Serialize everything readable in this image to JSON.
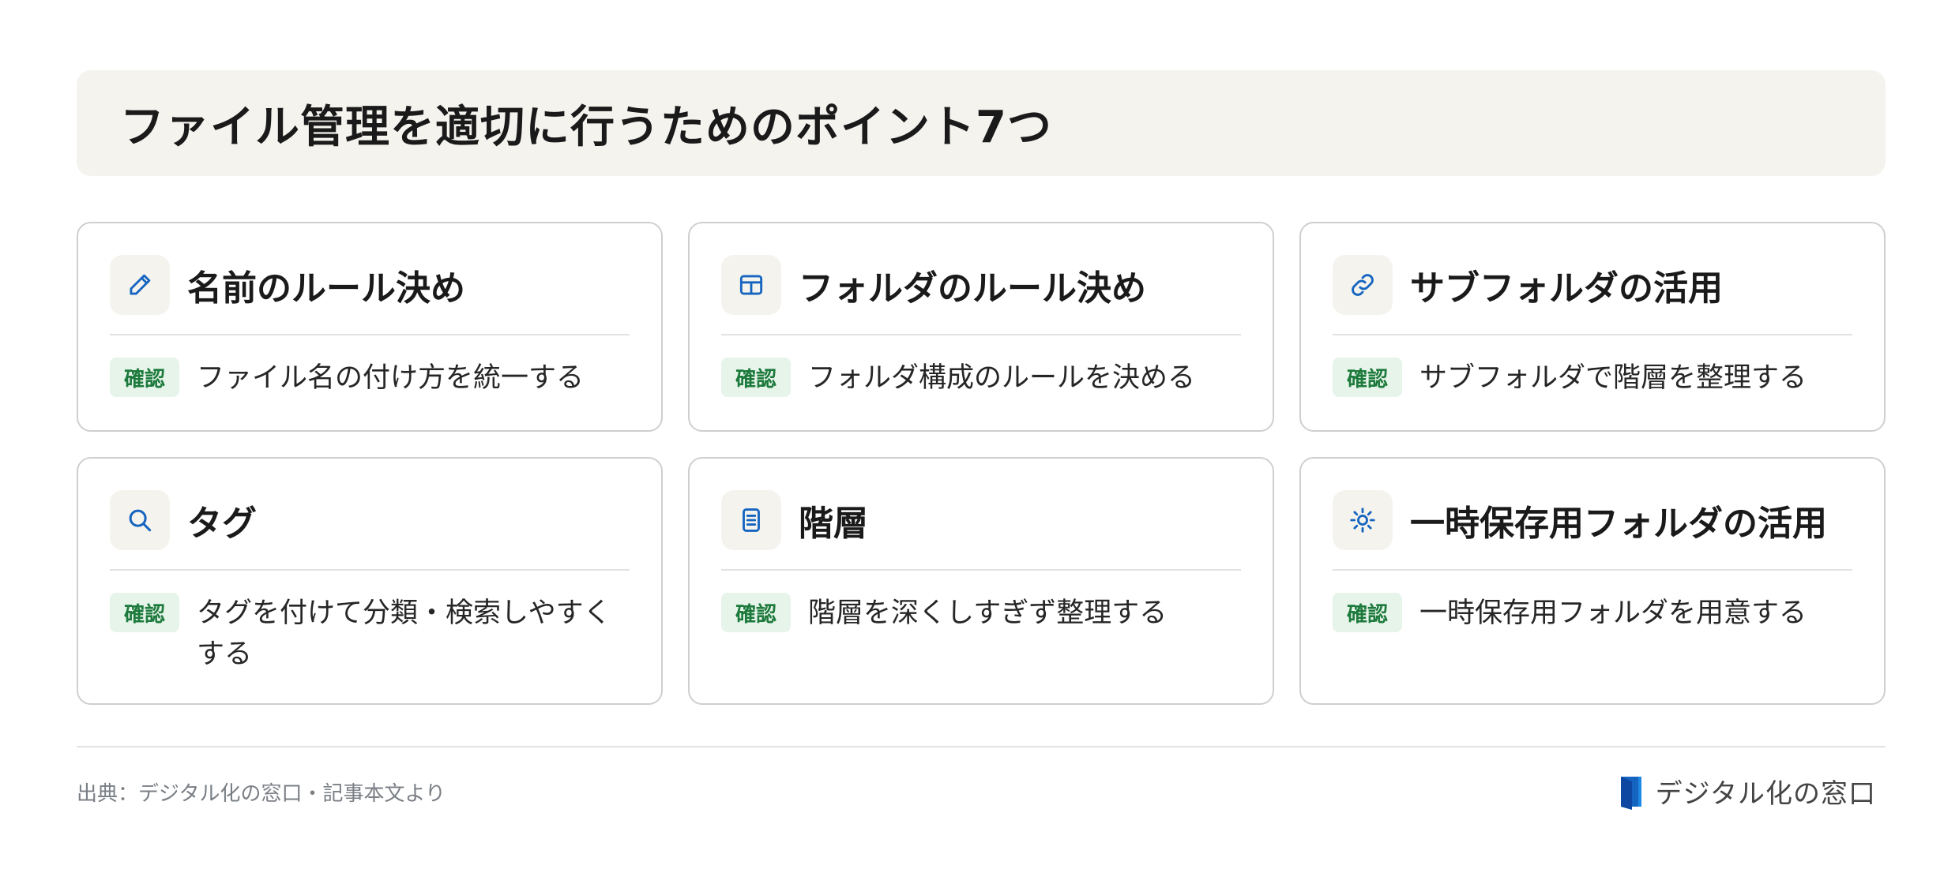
{
  "header": {
    "title": "ファイル管理を適切に行うためのポイント7つ"
  },
  "badge_label": "確認",
  "cards": [
    {
      "title": "名前のルール決め",
      "text": "ファイル名の付け方を統一する",
      "icon": "pencil-icon"
    },
    {
      "title": "フォルダのルール決め",
      "text": "フォルダ構成のルールを決める",
      "icon": "grid-table-icon"
    },
    {
      "title": "サブフォルダの活用",
      "text": "サブフォルダで階層を整理する",
      "icon": "link-icon"
    },
    {
      "title": "タグ",
      "text": "タグを付けて分類・検索しやすくする",
      "icon": "search-icon"
    },
    {
      "title": "階層",
      "text": "階層を深くしすぎず整理する",
      "icon": "document-icon"
    },
    {
      "title": "一時保存用フォルダの活用",
      "text": "一時保存用フォルダを用意する",
      "icon": "sun-icon"
    }
  ],
  "footer": {
    "source": "出典：デジタル化の窓口・記事本文より",
    "brand": "デジタル化の窓口"
  },
  "colors": {
    "accent": "#1565c0",
    "badge_bg": "#e6f4ea",
    "badge_text": "#1d7a3c",
    "header_bg": "#f5f3ee"
  }
}
